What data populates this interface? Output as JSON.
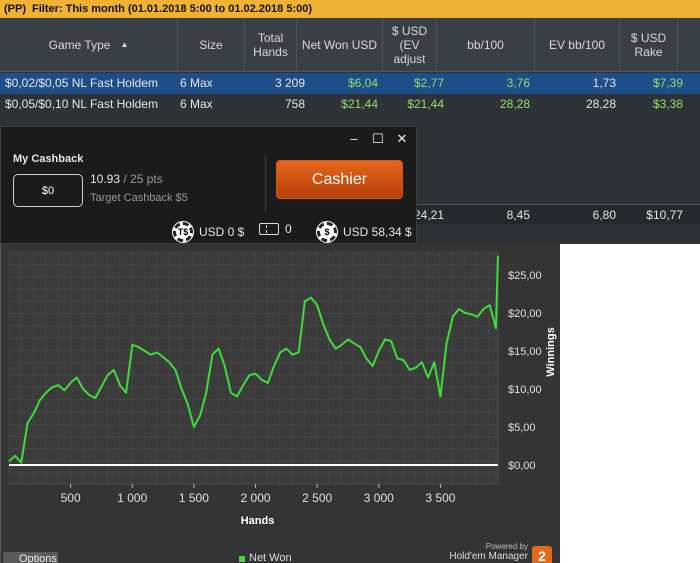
{
  "filter": {
    "prefix": "(PP)",
    "text": "Filter: This month (01.01.2018 5:00 to 01.02.2018 5:00)"
  },
  "table": {
    "headers": {
      "game_type": "Game Type",
      "size": "Size",
      "total_hands": "Total Hands",
      "net_won": "Net Won USD",
      "usd_ev": "$ USD (EV adjust",
      "bb100": "bb/100",
      "ev_bb100": "EV bb/100",
      "rake": "$ USD Rake"
    },
    "rows": [
      {
        "game": "$0,02/$0,05 NL Fast Holdem",
        "size": "6 Max",
        "hands": "3 209",
        "net": "$6,04",
        "ev": "$2,77",
        "bb100": "3,76",
        "evbb": "1,73",
        "rake": "$7,39"
      },
      {
        "game": "$0,05/$0,10 NL Fast Holdem",
        "size": "6 Max",
        "hands": "758",
        "net": "$21,44",
        "ev": "$21,44",
        "bb100": "28,28",
        "evbb": "28,28",
        "rake": "$3,38"
      }
    ],
    "totals": {
      "ev": "24,21",
      "bb100": "8,45",
      "evbb": "6,80",
      "rake": "$10,77"
    }
  },
  "cashback": {
    "title": "My Cashback",
    "balance": "$0",
    "points": "10.93",
    "points_target": "/ 25 pts",
    "target": "Target Cashback $5",
    "cashier_label": "Cashier",
    "ts_icon_text": "T$",
    "ts_balance": "USD 0 $",
    "tickets": "0",
    "usd_icon_text": "$",
    "usd_balance": "USD 58,34 $"
  },
  "chart_data": {
    "type": "line",
    "xlabel": "Hands",
    "ylabel": "Winnings",
    "xlim": [
      0,
      3967
    ],
    "ylim": [
      -2.5,
      28
    ],
    "x_ticks": [
      "500",
      "1 000",
      "1 500",
      "2 000",
      "2 500",
      "3 000",
      "3 500"
    ],
    "y_ticks": [
      "$0,00",
      "$5,00",
      "$10,00",
      "$15,00",
      "$20,00",
      "$25,00"
    ],
    "series": [
      {
        "name": "Net Won",
        "color": "#3fdc3a",
        "x": [
          0,
          50,
          100,
          150,
          200,
          250,
          300,
          350,
          400,
          450,
          500,
          550,
          600,
          650,
          700,
          750,
          800,
          850,
          900,
          950,
          1000,
          1050,
          1100,
          1150,
          1200,
          1250,
          1300,
          1350,
          1400,
          1450,
          1500,
          1550,
          1600,
          1650,
          1700,
          1750,
          1800,
          1850,
          1900,
          1950,
          2000,
          2050,
          2100,
          2150,
          2200,
          2250,
          2300,
          2350,
          2400,
          2450,
          2500,
          2550,
          2600,
          2650,
          2700,
          2750,
          2800,
          2850,
          2900,
          2950,
          3000,
          3050,
          3100,
          3150,
          3200,
          3250,
          3300,
          3350,
          3400,
          3450,
          3500,
          3550,
          3600,
          3650,
          3700,
          3750,
          3800,
          3850,
          3900,
          3950,
          3967
        ],
        "y": [
          0.5,
          1.2,
          0.3,
          5.5,
          6.8,
          8.5,
          9.5,
          10.2,
          10.5,
          9.8,
          10.8,
          11.5,
          10.0,
          9.2,
          8.8,
          10.3,
          11.8,
          12.5,
          10.5,
          9.5,
          15.8,
          15.5,
          15.0,
          14.5,
          14.8,
          14.2,
          13.5,
          12.5,
          10.0,
          8.0,
          5.0,
          6.5,
          9.5,
          14.5,
          15.3,
          13.0,
          9.5,
          9.0,
          10.5,
          11.8,
          12.0,
          11.2,
          10.8,
          13.0,
          14.8,
          15.3,
          14.5,
          14.8,
          21.5,
          22.0,
          21.0,
          18.5,
          16.5,
          15.3,
          15.8,
          16.5,
          16.0,
          15.5,
          14.0,
          13.0,
          15.0,
          16.5,
          16.3,
          14.0,
          13.8,
          12.5,
          12.8,
          13.5,
          11.5,
          13.5,
          9.0,
          16.0,
          19.5,
          20.5,
          20.0,
          19.8,
          19.5,
          20.5,
          21.0,
          18.0,
          27.5
        ]
      }
    ],
    "legend_position": "bottom"
  },
  "chart_ui": {
    "options_label": "Options",
    "powered_by": "Powered by",
    "brand": "Hold'em Manager",
    "brand_badge": "2"
  }
}
